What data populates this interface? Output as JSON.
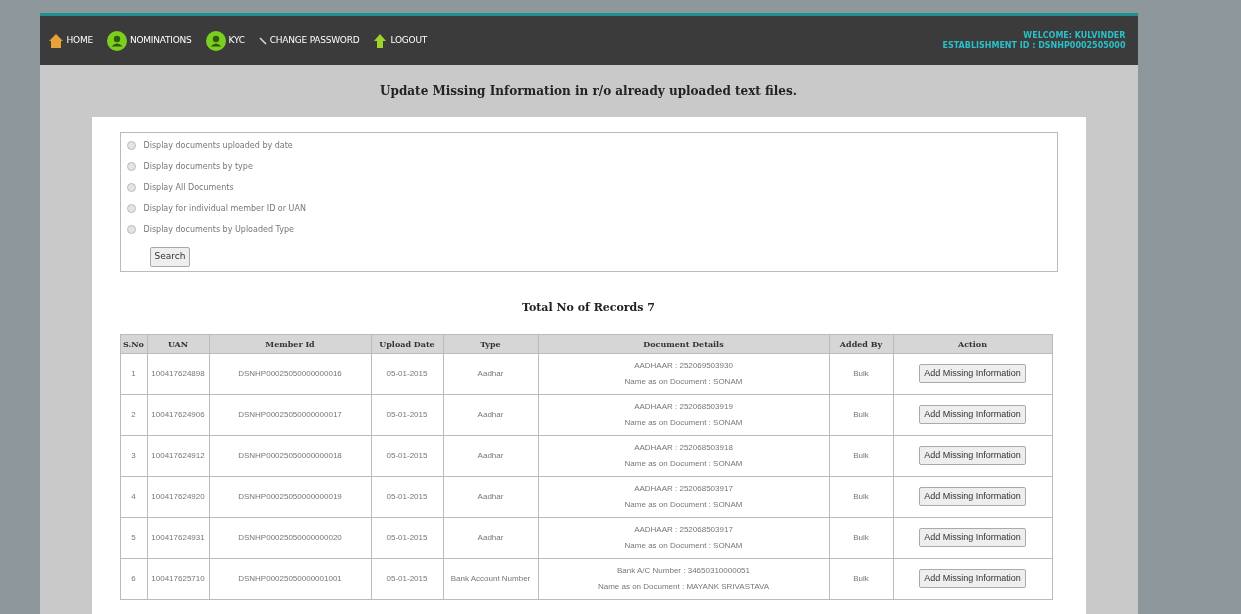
{
  "nav": [
    {
      "label": "HOME"
    },
    {
      "label": "NOMINATIONS"
    },
    {
      "label": "KYC"
    },
    {
      "label": "CHANGE PASSWORD"
    },
    {
      "label": "LOGOUT"
    }
  ],
  "welcome": "WELCOME: KULVINDER",
  "establishment": "ESTABLISHMENT ID : DSNHP0002505000",
  "title": "Update Missing Information in r/o already uploaded text files.",
  "options": [
    {
      "label": "Display documents uploaded by date",
      "selected": false
    },
    {
      "label": "Display documents by type",
      "selected": false
    },
    {
      "label": "Display All Documents",
      "selected": false
    },
    {
      "label": "Display for individual member ID or UAN",
      "selected": false
    },
    {
      "label": "Display documents by Uploaded Type",
      "selected": false
    }
  ],
  "search_button": "Search",
  "total": "Total No of Records 7",
  "columns": [
    "S.No",
    "UAN",
    "Member Id",
    "Upload Date",
    "Type",
    "Document Details",
    "Added By",
    "Action"
  ],
  "rows": [
    {
      "sno": "1",
      "uan": "100417624898",
      "member_id": "DSNHP00025050000000016",
      "date": "05-01-2015",
      "type": "Aadhar",
      "detail_1": "AADHAAR : 252069503930",
      "detail_2": "Name as on Document : SONAM",
      "added_by": "Bulk",
      "action": "Add Missing Information"
    },
    {
      "sno": "2",
      "uan": "100417624906",
      "member_id": "DSNHP00025050000000017",
      "date": "05-01-2015",
      "type": "Aadhar",
      "detail_1": "AADHAAR : 252068503919",
      "detail_2": "Name as on Document : SONAM",
      "added_by": "Bulk",
      "action": "Add Missing Information"
    },
    {
      "sno": "3",
      "uan": "100417624912",
      "member_id": "DSNHP00025050000000018",
      "date": "05-01-2015",
      "type": "Aadhar",
      "detail_1": "AADHAAR : 252068503918",
      "detail_2": "Name as on Document : SONAM",
      "added_by": "Bulk",
      "action": "Add Missing Information"
    },
    {
      "sno": "4",
      "uan": "100417624920",
      "member_id": "DSNHP00025050000000019",
      "date": "05-01-2015",
      "type": "Aadhar",
      "detail_1": "AADHAAR : 252068503917",
      "detail_2": "Name as on Document : SONAM",
      "added_by": "Bulk",
      "action": "Add Missing Information"
    },
    {
      "sno": "5",
      "uan": "100417624931",
      "member_id": "DSNHP00025050000000020",
      "date": "05-01-2015",
      "type": "Aadhar",
      "detail_1": "AADHAAR : 252068503917",
      "detail_2": "Name as on Document : SONAM",
      "added_by": "Bulk",
      "action": "Add Missing Information"
    },
    {
      "sno": "6",
      "uan": "100417625710",
      "member_id": "DSNHP00025050000001001",
      "date": "05-01-2015",
      "type": "Bank Account Number",
      "detail_1": "Bank A/C Number : 34650310000051",
      "detail_2": "Name as on Document : MAYANK SRIVASTAVA",
      "added_by": "Bulk",
      "action": "Add Missing Information"
    }
  ]
}
